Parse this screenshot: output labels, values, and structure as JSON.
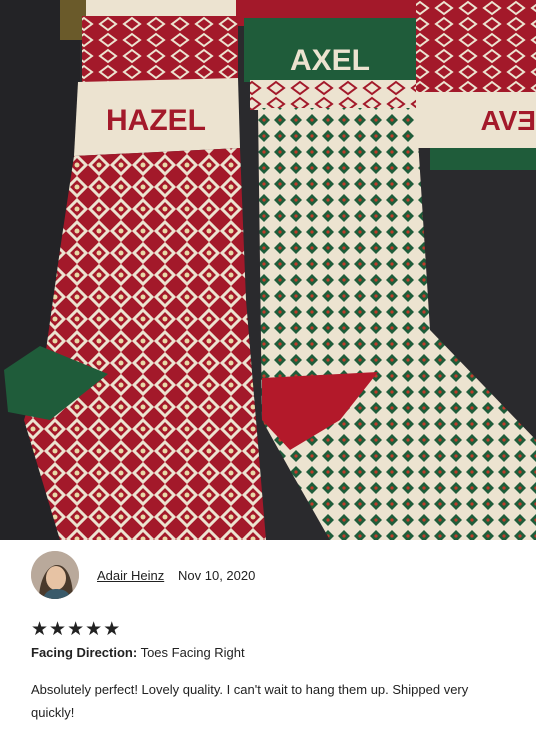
{
  "photo": {
    "alt_names": [
      "HAZEL",
      "AXEL",
      "EVA"
    ],
    "colors": {
      "red": "#a3192a",
      "green": "#1f5c3a",
      "cream": "#ece3d0",
      "dark": "#2b2b2e"
    }
  },
  "review": {
    "reviewer_name": "Adair Heinz",
    "date": "Nov 10, 2020",
    "rating": 5,
    "stars": [
      "★",
      "★",
      "★",
      "★",
      "★"
    ],
    "attribute_label": "Facing Direction:",
    "attribute_value": "Toes Facing Right",
    "text": "Absolutely perfect! Lovely quality. I can't wait to hang them up. Shipped very quickly!"
  }
}
